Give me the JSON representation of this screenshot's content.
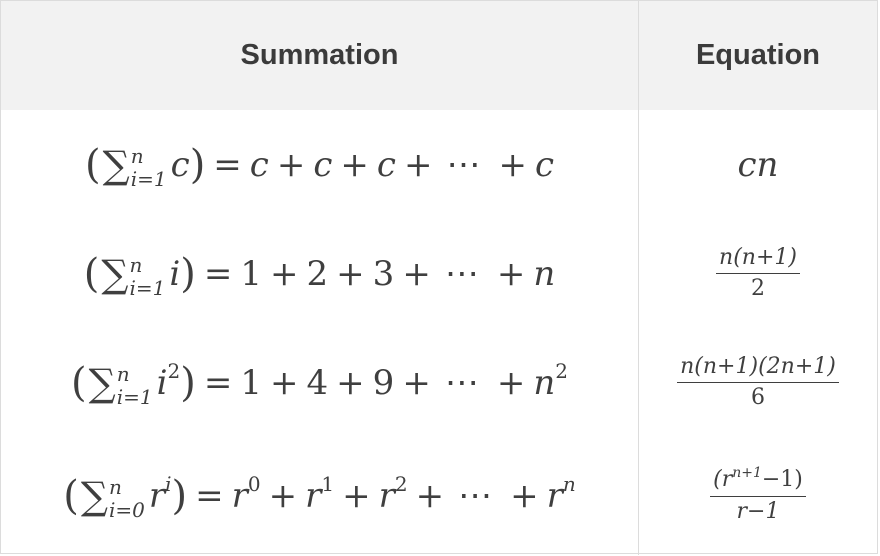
{
  "table": {
    "headers": {
      "summation": "Summation",
      "equation": "Equation"
    },
    "rows": [
      {
        "summation": {
          "var": "c",
          "lower": "i=1",
          "upper": "n",
          "rhs": [
            "c",
            "c",
            "c",
            "c"
          ]
        },
        "equation": "cn"
      },
      {
        "summation": {
          "var": "i",
          "lower": "i=1",
          "upper": "n",
          "rhs": [
            "1",
            "2",
            "3",
            "n"
          ]
        },
        "equation": {
          "num": "n(n+1)",
          "den": "2"
        }
      },
      {
        "summation": {
          "var": "i",
          "var_exp": "2",
          "lower": "i=1",
          "upper": "n",
          "rhs": [
            "1",
            "4",
            "9",
            "n"
          ],
          "last_exp": "2"
        },
        "equation": {
          "num": "n(n+1)(2n+1)",
          "den": "6"
        }
      },
      {
        "summation": {
          "var": "r",
          "var_exp": "i",
          "lower": "i=0",
          "upper": "n",
          "rhs_base": "r",
          "rhs_exps": [
            "0",
            "1",
            "2",
            "n"
          ]
        },
        "equation": {
          "num_base": "(r",
          "num_exp": "n+1",
          "num_tail": "−1)",
          "den": "r−1"
        }
      }
    ],
    "symbols": {
      "sigma": "∑",
      "open": "(",
      "close": ")",
      "equals": "=",
      "plus": "+",
      "dots": "⋯"
    }
  }
}
